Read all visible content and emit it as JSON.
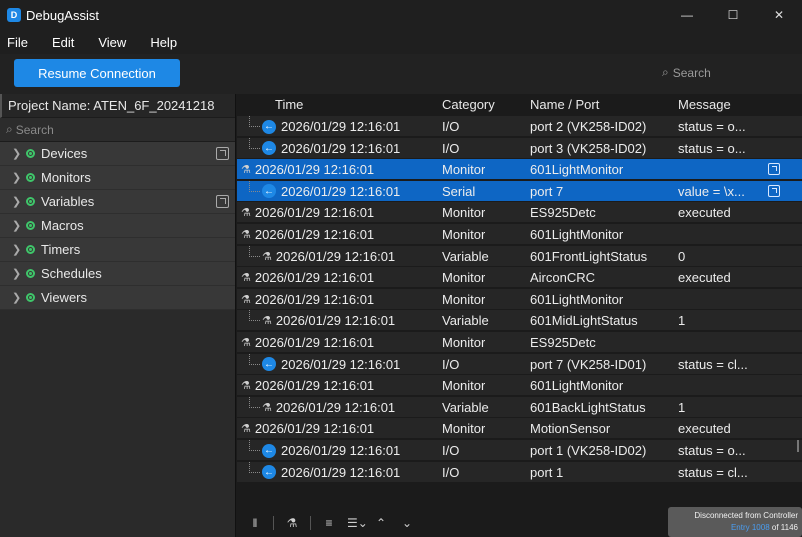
{
  "app": {
    "title": "DebugAssist",
    "icon": "app-logo-icon"
  },
  "window_controls": {
    "minimize": "—",
    "maximize": "☐",
    "close": "✕"
  },
  "menu": [
    "File",
    "Edit",
    "View",
    "Help"
  ],
  "toolbar": {
    "resume_label": "Resume Connection",
    "search_placeholder": "Search"
  },
  "left": {
    "project_label": "Project Name: ATEN_6F_20241218",
    "search_placeholder": "Search",
    "items": [
      {
        "label": "Devices",
        "has_open": true
      },
      {
        "label": "Monitors",
        "has_open": false
      },
      {
        "label": "Variables",
        "has_open": true
      },
      {
        "label": "Macros",
        "has_open": false
      },
      {
        "label": "Timers",
        "has_open": false
      },
      {
        "label": "Schedules",
        "has_open": false
      },
      {
        "label": "Viewers",
        "has_open": false
      }
    ]
  },
  "log": {
    "headers": {
      "time": "Time",
      "category": "Category",
      "name": "Name / Port",
      "message": "Message"
    },
    "rows": [
      {
        "time": "2026/01/29 12:16:01",
        "category": "I/O",
        "name": "port 2 (VK258-ID02)",
        "message": "status = o...",
        "icon": "arrow",
        "indent": 1,
        "selected": false
      },
      {
        "time": "2026/01/29 12:16:01",
        "category": "I/O",
        "name": "port 3 (VK258-ID02)",
        "message": "status = o...",
        "icon": "arrow",
        "indent": 1,
        "selected": false
      },
      {
        "time": "2026/01/29 12:16:01",
        "category": "Monitor",
        "name": "601LightMonitor",
        "message": "",
        "icon": "net",
        "indent": 0,
        "selected": true,
        "open": true
      },
      {
        "time": "2026/01/29 12:16:01",
        "category": "Serial",
        "name": "port 7",
        "message": "value = \\x...",
        "icon": "arrow",
        "indent": 1,
        "selected": true,
        "open": true
      },
      {
        "time": "2026/01/29 12:16:01",
        "category": "Monitor",
        "name": "ES925Detc",
        "message": "executed",
        "icon": "net",
        "indent": 0,
        "selected": false
      },
      {
        "time": "2026/01/29 12:16:01",
        "category": "Monitor",
        "name": "601LightMonitor",
        "message": "",
        "icon": "net",
        "indent": 0,
        "selected": false
      },
      {
        "time": "2026/01/29 12:16:01",
        "category": "Variable",
        "name": "601FrontLightStatus",
        "message": "0",
        "icon": "net",
        "indent": 1,
        "selected": false
      },
      {
        "time": "2026/01/29 12:16:01",
        "category": "Monitor",
        "name": "AirconCRC",
        "message": "executed",
        "icon": "net",
        "indent": 0,
        "selected": false
      },
      {
        "time": "2026/01/29 12:16:01",
        "category": "Monitor",
        "name": "601LightMonitor",
        "message": "",
        "icon": "net",
        "indent": 0,
        "selected": false
      },
      {
        "time": "2026/01/29 12:16:01",
        "category": "Variable",
        "name": "601MidLightStatus",
        "message": "1",
        "icon": "net",
        "indent": 1,
        "selected": false
      },
      {
        "time": "2026/01/29 12:16:01",
        "category": "Monitor",
        "name": "ES925Detc",
        "message": "",
        "icon": "net",
        "indent": 0,
        "selected": false
      },
      {
        "time": "2026/01/29 12:16:01",
        "category": "I/O",
        "name": "port 7 (VK258-ID01)",
        "message": "status = cl...",
        "icon": "arrow",
        "indent": 1,
        "selected": false
      },
      {
        "time": "2026/01/29 12:16:01",
        "category": "Monitor",
        "name": "601LightMonitor",
        "message": "",
        "icon": "net",
        "indent": 0,
        "selected": false
      },
      {
        "time": "2026/01/29 12:16:01",
        "category": "Variable",
        "name": "601BackLightStatus",
        "message": "1",
        "icon": "net",
        "indent": 1,
        "selected": false
      },
      {
        "time": "2026/01/29 12:16:01",
        "category": "Monitor",
        "name": "MotionSensor",
        "message": "executed",
        "icon": "net",
        "indent": 0,
        "selected": false
      },
      {
        "time": "2026/01/29 12:16:01",
        "category": "I/O",
        "name": "port 1 (VK258-ID02)",
        "message": "status = o...",
        "icon": "arrow",
        "indent": 1,
        "selected": false
      },
      {
        "time": "2026/01/29 12:16:01",
        "category": "I/O",
        "name": "port 1",
        "message": "status = cl...",
        "icon": "arrow",
        "indent": 1,
        "selected": false
      }
    ]
  },
  "bottom_toolbar": [
    "pause-icon",
    "network-filter-icon",
    "wrap-lines-icon",
    "filter-settings-icon",
    "scroll-up-icon",
    "scroll-down-icon"
  ],
  "status": {
    "line1": "Disconnected from Controller",
    "entry_prefix": "Entry",
    "entry_current": "1008",
    "entry_sep": "of",
    "entry_total": "1146"
  },
  "colors": {
    "accent": "#1e88e5",
    "selected_row": "#0e66c4",
    "status_green": "#3fc66a"
  }
}
